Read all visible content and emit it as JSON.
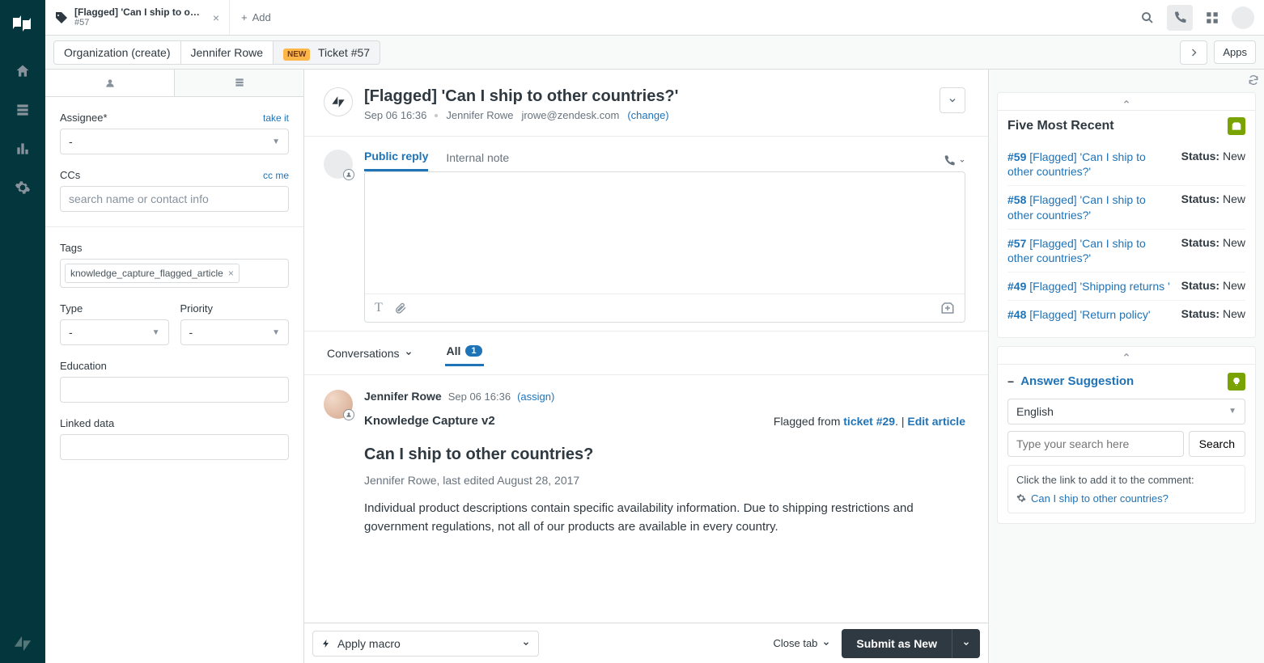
{
  "tab": {
    "title": "[Flagged] 'Can I ship to o…",
    "subtitle": "#57",
    "add_label": "Add"
  },
  "context": {
    "org": "Organization (create)",
    "user": "Jennifer Rowe",
    "new_badge": "NEW",
    "ticket": "Ticket #57",
    "apps_btn": "Apps"
  },
  "sidebar": {
    "assignee_label": "Assignee*",
    "take_it": "take it",
    "assignee_value": "-",
    "ccs_label": "CCs",
    "cc_me": "cc me",
    "ccs_placeholder": "search name or contact info",
    "tags_label": "Tags",
    "tag_value": "knowledge_capture_flagged_article",
    "type_label": "Type",
    "type_value": "-",
    "priority_label": "Priority",
    "priority_value": "-",
    "education_label": "Education",
    "linked_label": "Linked data"
  },
  "ticket": {
    "title": "[Flagged] 'Can I ship to other countries?'",
    "date": "Sep 06 16:36",
    "requester": "Jennifer Rowe",
    "email": "jrowe@zendesk.com",
    "change": "(change)"
  },
  "compose": {
    "public_reply": "Public reply",
    "internal_note": "Internal note"
  },
  "convo": {
    "dropdown": "Conversations",
    "filter": "All",
    "count": "1"
  },
  "event": {
    "author": "Jennifer Rowe",
    "time": "Sep 06 16:36",
    "assign": "(assign)",
    "app": "Knowledge Capture v2",
    "flag_prefix": "Flagged from ",
    "flag_ticket": "ticket #29",
    "flag_sep": ". | ",
    "edit_article": "Edit article",
    "article_title": "Can I ship to other countries?",
    "article_meta": "Jennifer Rowe, last edited August 28, 2017",
    "article_body": "Individual product descriptions contain specific availability information. Due to shipping restrictions and government regulations, not all of our products are available in every country."
  },
  "footer": {
    "macro": "Apply macro",
    "close_tab": "Close tab",
    "submit": "Submit as New"
  },
  "recent": {
    "title": "Five Most Recent",
    "status_label": "Status:",
    "items": [
      {
        "id": "#59",
        "title": "[Flagged] 'Can I ship to other countries?'",
        "status": "New"
      },
      {
        "id": "#58",
        "title": "[Flagged] 'Can I ship to other countries?'",
        "status": "New"
      },
      {
        "id": "#57",
        "title": "[Flagged] 'Can I ship to other countries?'",
        "status": "New"
      },
      {
        "id": "#49",
        "title": "[Flagged] 'Shipping returns '",
        "status": "New"
      },
      {
        "id": "#48",
        "title": "[Flagged] 'Return policy'",
        "status": "New"
      }
    ]
  },
  "answer": {
    "title": "Answer Suggestion",
    "language": "English",
    "search_placeholder": "Type your search here",
    "search_btn": "Search",
    "hint": "Click the link to add it to the comment:",
    "suggestion": "Can I ship to other countries?"
  }
}
